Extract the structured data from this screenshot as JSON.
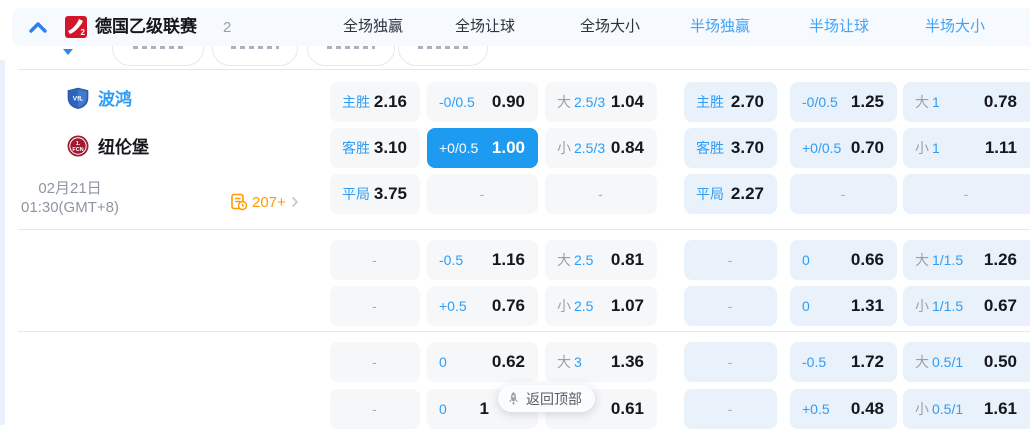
{
  "header": {
    "league_name": "德国乙级联赛",
    "match_count": "2",
    "columns": [
      {
        "label": "全场独赢",
        "active": false
      },
      {
        "label": "全场让球",
        "active": false
      },
      {
        "label": "全场大小",
        "active": false
      },
      {
        "label": "半场独赢",
        "active": true
      },
      {
        "label": "半场让球",
        "active": true
      },
      {
        "label": "半场大小",
        "active": true
      }
    ]
  },
  "match": {
    "home_team": "波鸿",
    "away_team": "纽伦堡",
    "date": "02月21日",
    "time": "01:30(GMT+8)",
    "history_count": "207+"
  },
  "odds": {
    "dash": "-",
    "rows": [
      {
        "cells": [
          {
            "label": "主胜",
            "value": "2.16"
          },
          {
            "label": "-0/0.5",
            "value": "0.90"
          },
          {
            "prefix": "大",
            "label": "2.5/3",
            "value": "1.04"
          },
          {
            "label": "主胜",
            "value": "2.70"
          },
          {
            "label": "-0/0.5",
            "value": "1.25"
          },
          {
            "prefix": "大",
            "label": "1",
            "value": "0.78"
          }
        ]
      },
      {
        "cells": [
          {
            "label": "客胜",
            "value": "3.10"
          },
          {
            "label": "+0/0.5",
            "value": "1.00",
            "selected": true
          },
          {
            "prefix": "小",
            "label": "2.5/3",
            "value": "0.84"
          },
          {
            "label": "客胜",
            "value": "3.70"
          },
          {
            "label": "+0/0.5",
            "value": "0.70"
          },
          {
            "prefix": "小",
            "label": "1",
            "value": "1.11"
          }
        ]
      },
      {
        "cells": [
          {
            "label": "平局",
            "value": "3.75"
          },
          {
            "dash": true
          },
          {
            "dash": true
          },
          {
            "label": "平局",
            "value": "2.27"
          },
          {
            "dash": true
          },
          {
            "dash": true
          }
        ]
      },
      {
        "cells": [
          {
            "dash": true
          },
          {
            "label": "-0.5",
            "value": "1.16"
          },
          {
            "prefix": "大",
            "label": "2.5",
            "value": "0.81"
          },
          {
            "dash": true
          },
          {
            "label": "0",
            "value": "0.66"
          },
          {
            "prefix": "大",
            "label": "1/1.5",
            "value": "1.26"
          }
        ]
      },
      {
        "cells": [
          {
            "dash": true
          },
          {
            "label": "+0.5",
            "value": "0.76"
          },
          {
            "prefix": "小",
            "label": "2.5",
            "value": "1.07"
          },
          {
            "dash": true
          },
          {
            "label": "0",
            "value": "1.31"
          },
          {
            "prefix": "小",
            "label": "1/1.5",
            "value": "0.67"
          }
        ]
      },
      {
        "cells": [
          {
            "dash": true
          },
          {
            "label": "0",
            "value": "0.62"
          },
          {
            "prefix": "大",
            "label": "3",
            "value": "1.36"
          },
          {
            "dash": true
          },
          {
            "label": "-0.5",
            "value": "1.72"
          },
          {
            "prefix": "大",
            "label": "0.5/1",
            "value": "0.50"
          }
        ]
      },
      {
        "cells": [
          {
            "dash": true
          },
          {
            "label": "0",
            "value": "1",
            "clipped": true
          },
          {
            "label": "",
            "value": "0.61"
          },
          {
            "dash": true
          },
          {
            "label": "+0.5",
            "value": "0.48"
          },
          {
            "prefix": "小",
            "label": "0.5/1",
            "value": "1.61"
          }
        ]
      }
    ]
  },
  "back_to_top": {
    "label": "返回顶部"
  },
  "colors": {
    "accent": "#1d9bf0",
    "half_header_blue": "#41a3f6",
    "orange": "#ff9a00"
  }
}
